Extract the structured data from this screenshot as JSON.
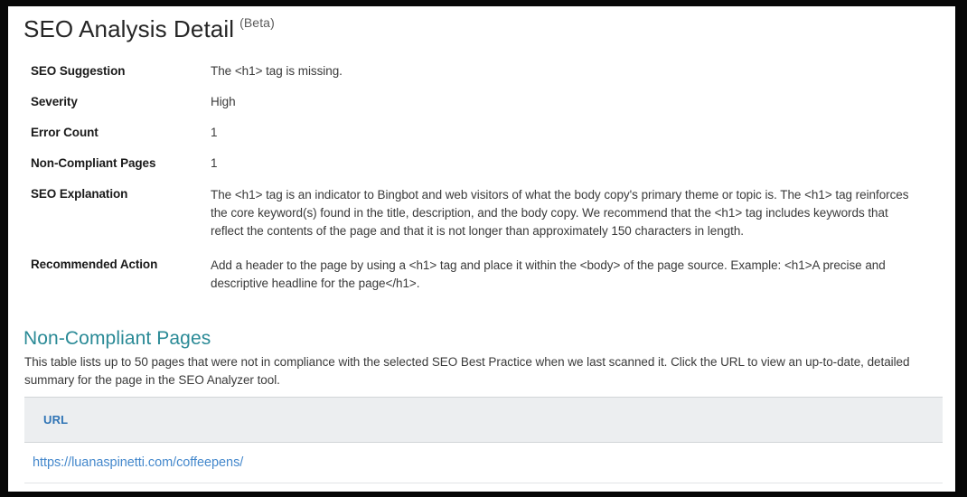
{
  "header": {
    "title": "SEO Analysis Detail",
    "beta_label": "(Beta)"
  },
  "details": {
    "rows": [
      {
        "label": "SEO Suggestion",
        "value": "The <h1> tag is missing."
      },
      {
        "label": "Severity",
        "value": "High"
      },
      {
        "label": "Error Count",
        "value": "1"
      },
      {
        "label": "Non-Compliant Pages",
        "value": "1"
      },
      {
        "label": "SEO Explanation",
        "value": "The <h1> tag is an indicator to Bingbot and web visitors of what the body copy's primary theme or topic is.  The <h1> tag reinforces the core keyword(s)  found in the title, description, and the body copy. We recommend that the <h1> tag includes keywords that reflect the contents of the page and that it is not longer than approximately 150 characters in length."
      },
      {
        "label": "Recommended Action",
        "value": "Add a header to the page by using a <h1> tag and place it within the <body> of the page source. Example: <h1>A precise and descriptive headline for the page</h1>."
      }
    ]
  },
  "section": {
    "heading": "Non-Compliant Pages",
    "description": "This table lists up to 50 pages that were not in compliance with the selected SEO Best Practice when we last scanned it. Click the URL to view an up-to-date, detailed summary for the page in the SEO Analyzer tool."
  },
  "table": {
    "columns": [
      "URL"
    ],
    "rows": [
      {
        "url": "https://luanaspinetti.com/coffeepens/"
      }
    ]
  },
  "colors": {
    "heading_teal": "#2a8a96",
    "link_blue": "#4488cc",
    "table_header_blue": "#2f74b5",
    "table_header_bg": "#eceef0",
    "label_text": "#1a1a1a",
    "value_text": "#3a3a3a",
    "beta_gray": "#5b5b5b",
    "frame": "#080808"
  }
}
